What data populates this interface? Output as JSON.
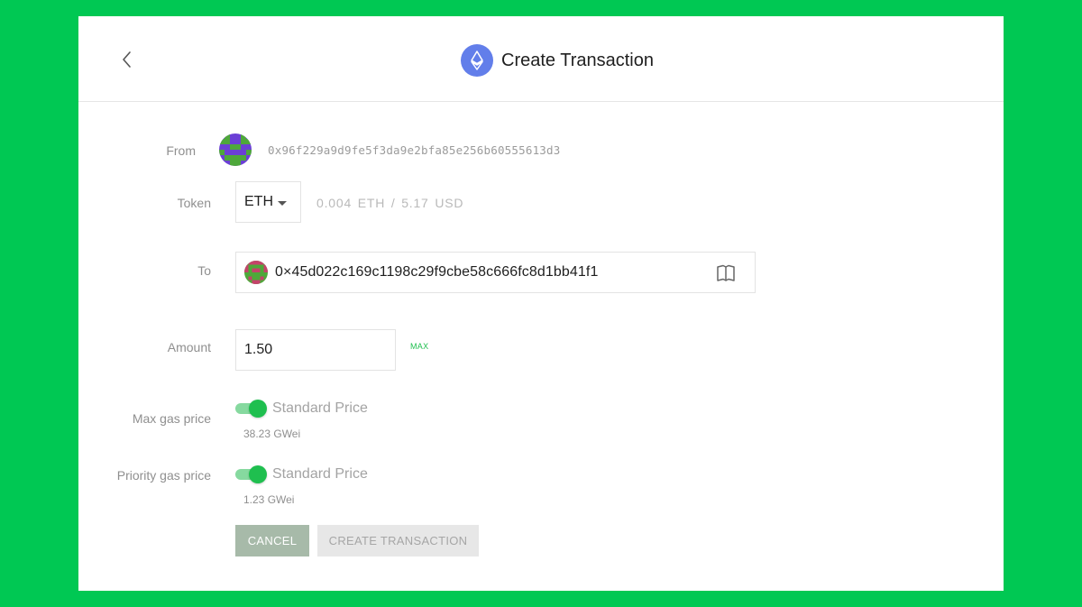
{
  "header": {
    "title": "Create Transaction",
    "back_icon": "chevron-left-icon",
    "logo_icon": "ethereum-icon"
  },
  "form": {
    "from": {
      "label": "From",
      "address": "0x96f229a9d9fe5f3da9e2bfa85e256b60555613d3"
    },
    "token": {
      "label": "Token",
      "selected": "ETH",
      "balance": "0.004 ETH / 5.17 USD"
    },
    "to": {
      "label": "To",
      "address": "0×45d022c169c1198c29f9cbe58c666fc8d1bb41f1",
      "address_book_icon": "book-icon"
    },
    "amount": {
      "label": "Amount",
      "value": "1.50",
      "max_label": "MAX"
    },
    "max_gas": {
      "label": "Max gas price",
      "toggle_label": "Standard Price",
      "toggle_on": true,
      "value": "38.23 GWei"
    },
    "priority_gas": {
      "label": "Priority gas price",
      "toggle_label": "Standard Price",
      "toggle_on": true,
      "value": "1.23 GWei"
    }
  },
  "actions": {
    "cancel_label": "CANCEL",
    "create_label": "CREATE TRANSACTION"
  },
  "colors": {
    "background": "#00c853",
    "accent": "#1fbf4f",
    "eth_logo": "#627eea"
  }
}
